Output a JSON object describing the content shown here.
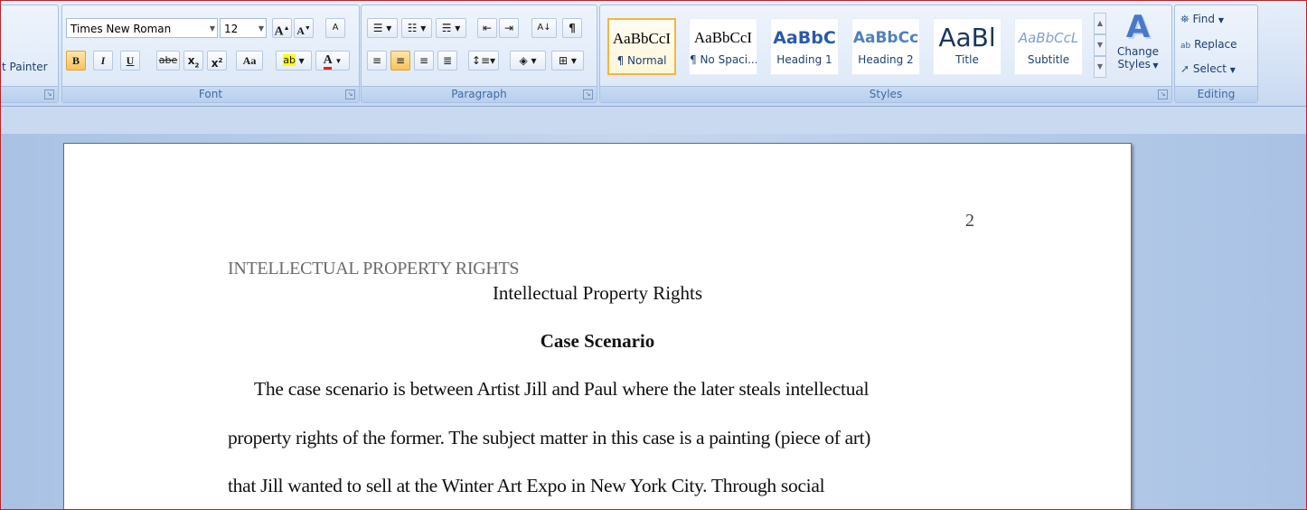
{
  "clipboard": {
    "format_painter_label": "t Painter",
    "launcher_icon": "dialog-launcher-icon"
  },
  "font": {
    "group_label": "Font",
    "font_name": "Times New Roman",
    "font_size": "12",
    "grow_label": "A",
    "shrink_label": "A",
    "clear_label": "A",
    "bold_label": "B",
    "italic_label": "I",
    "underline_label": "U",
    "strike_label": "abe",
    "subscript_label": "x",
    "superscript_label": "x",
    "case_label": "Aa",
    "highlight_label": "ab",
    "font_color_label": "A",
    "highlight_color": "#ffff00",
    "font_color": "#e02020"
  },
  "paragraph": {
    "group_label": "Paragraph",
    "sort_label": "A↓",
    "pilcrow": "¶"
  },
  "styles": {
    "group_label": "Styles",
    "items": [
      {
        "sample": "AaBbCcI",
        "name": "¶ Normal"
      },
      {
        "sample": "AaBbCcI",
        "name": "¶ No Spaci..."
      },
      {
        "sample": "AaBbC",
        "name": "Heading 1"
      },
      {
        "sample": "AaBbCc",
        "name": "Heading 2"
      },
      {
        "sample": "AaBl",
        "name": "Title"
      },
      {
        "sample": "AaBbCcL",
        "name": "Subtitle"
      }
    ],
    "change_styles_line1": "Change",
    "change_styles_line2": "Styles",
    "change_styles_icon": "A"
  },
  "editing": {
    "group_label": "Editing",
    "find_label": "Find",
    "replace_label": "Replace",
    "select_label": "Select",
    "replace_icon_text": "ab"
  },
  "document": {
    "page_number": "2",
    "running_head": "INTELLECTUAL PROPERTY RIGHTS",
    "title": "Intellectual Property Rights",
    "heading": "Case Scenario",
    "lines": [
      "The case scenario is between Artist Jill and Paul where the later steals intellectual",
      "property rights of the former. The subject matter in this case is a painting (piece of art)",
      "that Jill wanted to sell at the Winter Art Expo in New York City. Through social"
    ]
  }
}
